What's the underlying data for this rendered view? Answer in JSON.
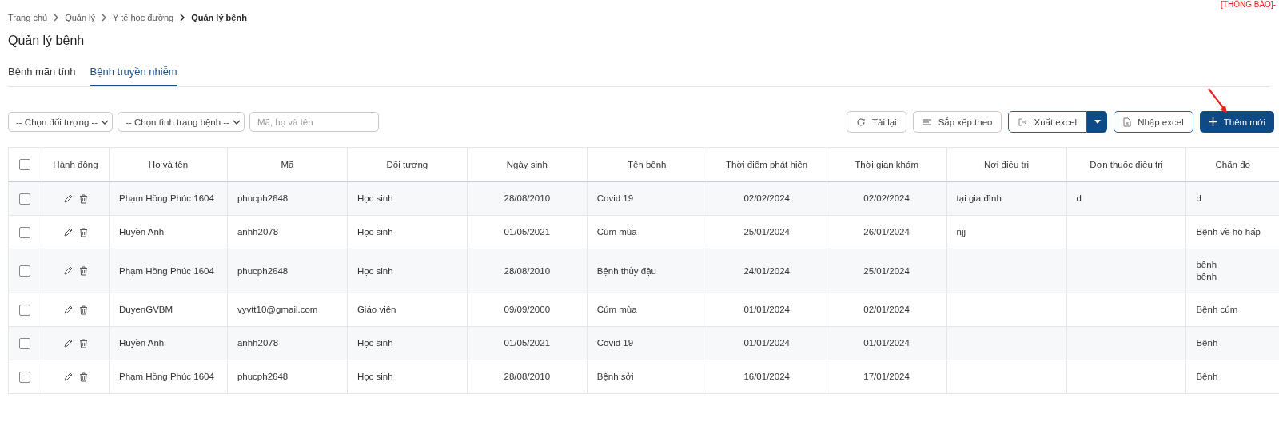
{
  "notice": "[THÔNG BÁO]-",
  "breadcrumb": [
    {
      "label": "Trang chủ",
      "current": false
    },
    {
      "label": "Quản lý",
      "current": false
    },
    {
      "label": "Y tế học đường",
      "current": false
    },
    {
      "label": "Quản lý bệnh",
      "current": true
    }
  ],
  "page_title": "Quản lý bệnh",
  "tabs": [
    {
      "label": "Bệnh mãn tính",
      "selected": false
    },
    {
      "label": "Bệnh truyền nhiễm",
      "selected": true
    }
  ],
  "filters": {
    "selects": [
      "-- Chọn đối tượng --",
      "-- Chọn tình trạng bệnh --"
    ],
    "search": {
      "placeholder": "Mã, họ và tên"
    }
  },
  "buttons": [
    {
      "label": "Tải lại",
      "kind": "plain"
    },
    {
      "label": "Sắp xếp theo",
      "kind": "plain"
    },
    {
      "label": "Xuất excel",
      "kind": "split"
    },
    {
      "label": "Nhập excel",
      "kind": "outline"
    },
    {
      "label": "Thêm mới",
      "kind": "primary"
    }
  ],
  "table": {
    "select_all": {
      "checked": false
    },
    "columns": [
      "Hành động",
      "Họ và tên",
      "Mã",
      "Đối tượng",
      "Ngày sinh",
      "Tên bệnh",
      "Thời điểm phát hiện",
      "Thời gian khám",
      "Nơi điều trị",
      "Đơn thuốc điều trị",
      "Chẩn đo"
    ],
    "rows": [
      {
        "checked": false,
        "cells": [
          "",
          "Phạm Hồng Phúc 1604",
          "phucph2648",
          "Học sinh",
          "28/08/2010",
          "Covid 19",
          "02/02/2024",
          "02/02/2024",
          "tại gia đình",
          "d",
          "d"
        ]
      },
      {
        "checked": false,
        "cells": [
          "",
          "Huyền Anh",
          "anhh2078",
          "Học sinh",
          "01/05/2021",
          "Cúm mùa",
          "25/01/2024",
          "26/01/2024",
          "njj",
          "",
          "Bệnh về hô hấp"
        ]
      },
      {
        "checked": false,
        "cells": [
          "",
          "Phạm Hồng Phúc 1604",
          "phucph2648",
          "Học sinh",
          "28/08/2010",
          "Bệnh thủy đậu",
          "24/01/2024",
          "25/01/2024",
          "",
          "",
          "bệnh\nbệnh"
        ]
      },
      {
        "checked": false,
        "cells": [
          "",
          "DuyenGVBM",
          "vyvtt10@gmail.com",
          "Giáo viên",
          "09/09/2000",
          "Cúm mùa",
          "01/01/2024",
          "02/01/2024",
          "",
          "",
          "Bệnh cúm"
        ]
      },
      {
        "checked": false,
        "cells": [
          "",
          "Huyền Anh",
          "anhh2078",
          "Học sinh",
          "01/05/2021",
          "Covid 19",
          "01/01/2024",
          "01/01/2024",
          "",
          "",
          "Bệnh"
        ]
      },
      {
        "checked": false,
        "cells": [
          "",
          "Phạm Hồng Phúc 1604",
          "phucph2648",
          "Học sinh",
          "28/08/2010",
          "Bệnh sởi",
          "16/01/2024",
          "17/01/2024",
          "",
          "",
          "Bệnh"
        ]
      }
    ]
  }
}
